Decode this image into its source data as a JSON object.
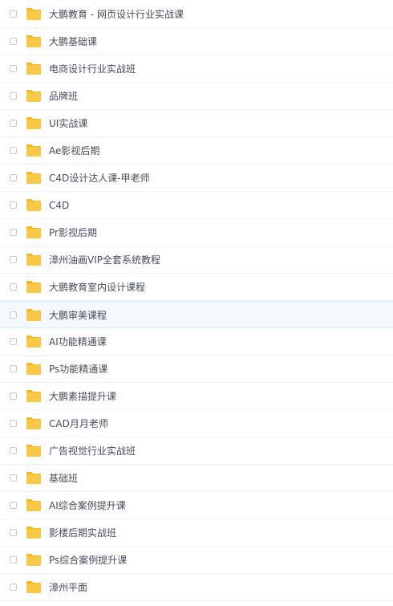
{
  "colors": {
    "folder": "#f9c846",
    "folder_tab": "#f4b823",
    "text": "#454d5a",
    "selected_row_bg": "#f4f9fe"
  },
  "files": [
    {
      "name": "大鹏教育 - 网页设计行业实战课",
      "icon": "folder-icon",
      "selected": false
    },
    {
      "name": "大鹏基础课",
      "icon": "folder-icon",
      "selected": false
    },
    {
      "name": "电商设计行业实战班",
      "icon": "folder-icon",
      "selected": false
    },
    {
      "name": "品牌班",
      "icon": "folder-icon",
      "selected": false
    },
    {
      "name": "UI实战课",
      "icon": "folder-icon",
      "selected": false
    },
    {
      "name": "Ae影视后期",
      "icon": "folder-icon",
      "selected": false
    },
    {
      "name": "C4D设计达人课-甲老师",
      "icon": "folder-icon",
      "selected": false
    },
    {
      "name": "C4D",
      "icon": "folder-icon",
      "selected": false
    },
    {
      "name": "Pr影视后期",
      "icon": "folder-icon",
      "selected": false
    },
    {
      "name": "漳州油画VIP全套系统教程",
      "icon": "folder-icon",
      "selected": false
    },
    {
      "name": "大鹏教育室内设计课程",
      "icon": "folder-icon",
      "selected": false
    },
    {
      "name": "大鹏审美课程",
      "icon": "folder-icon",
      "selected": true
    },
    {
      "name": "AI功能精通课",
      "icon": "folder-icon",
      "selected": false
    },
    {
      "name": "Ps功能精通课",
      "icon": "folder-icon",
      "selected": false
    },
    {
      "name": "大鹏素描提升课",
      "icon": "folder-icon",
      "selected": false
    },
    {
      "name": "CAD月月老师",
      "icon": "folder-icon",
      "selected": false
    },
    {
      "name": "广告视觉行业实战班",
      "icon": "folder-icon",
      "selected": false
    },
    {
      "name": "基础班",
      "icon": "folder-icon",
      "selected": false
    },
    {
      "name": "AI综合案例提升课",
      "icon": "folder-icon",
      "selected": false
    },
    {
      "name": "影楼后期实战班",
      "icon": "folder-icon",
      "selected": false
    },
    {
      "name": "Ps综合案例提升课",
      "icon": "folder-icon",
      "selected": false
    },
    {
      "name": "漳州平面",
      "icon": "folder-icon",
      "selected": false
    }
  ]
}
